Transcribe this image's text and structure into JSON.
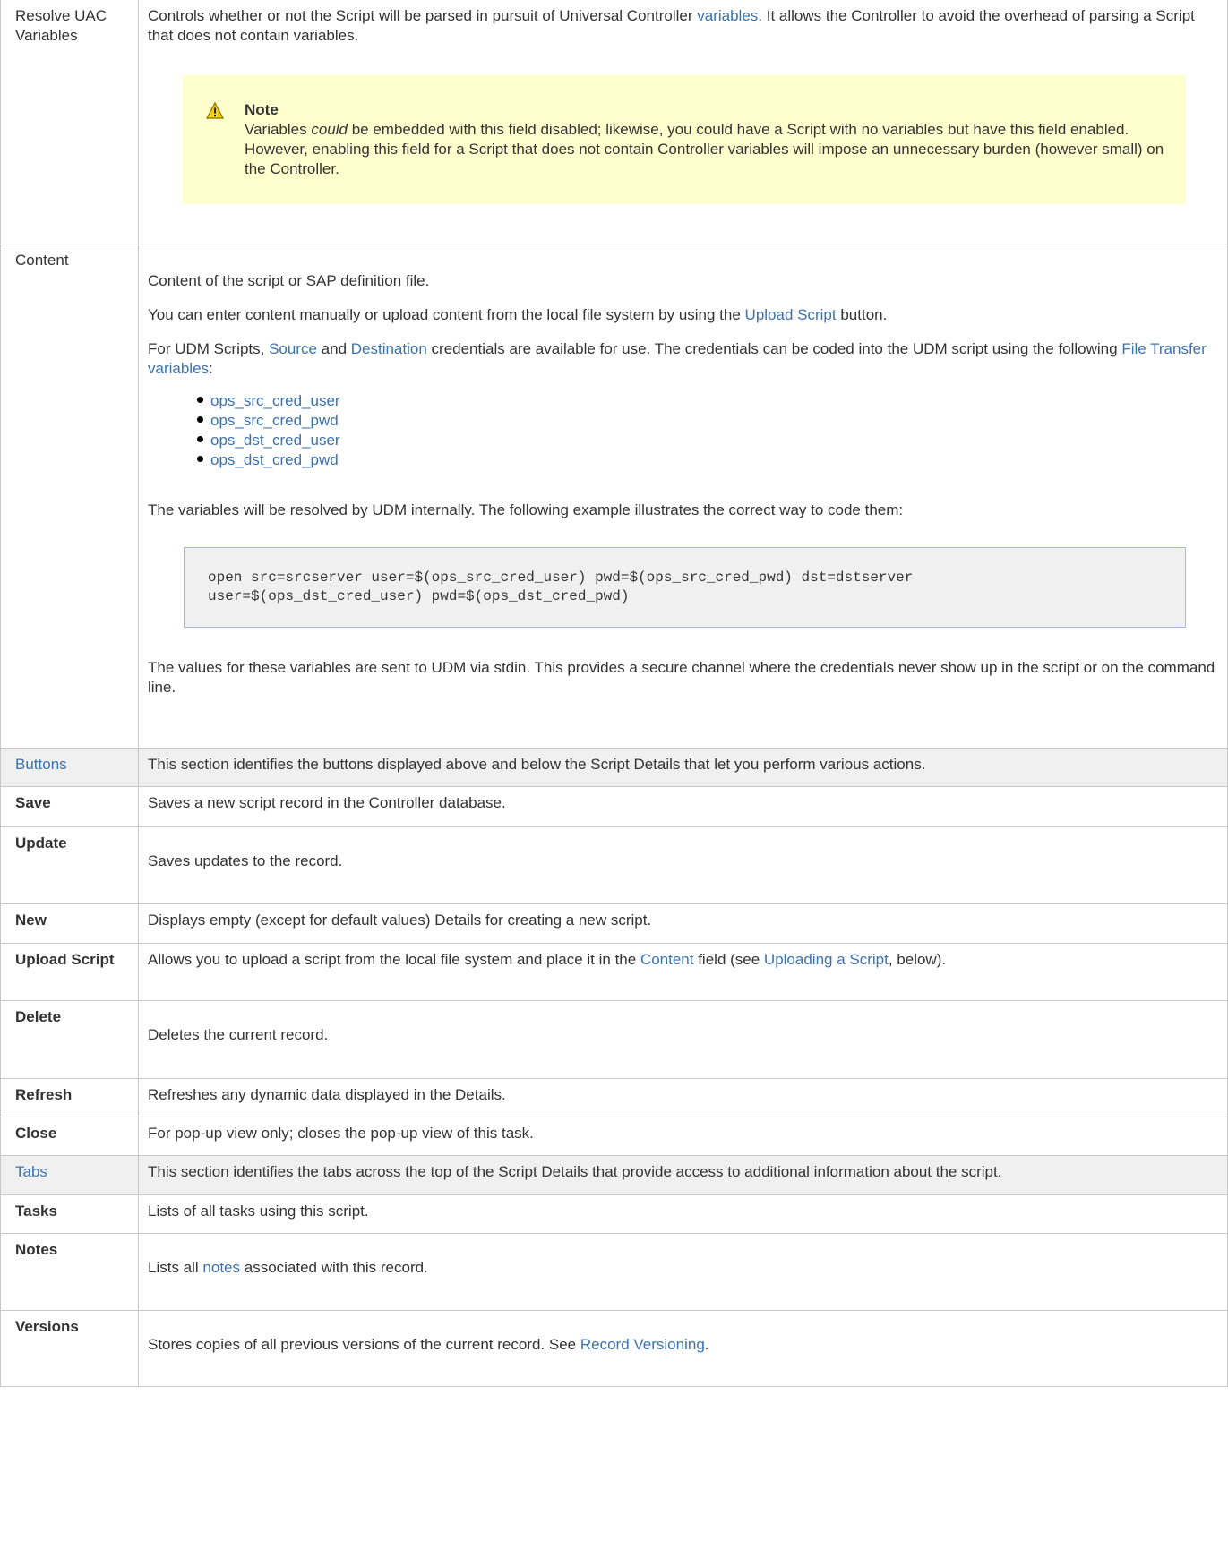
{
  "rows": {
    "resolve": {
      "label": "Resolve UAC Variables",
      "desc_a": "Controls whether or not the Script will be parsed in pursuit of Universal Controller ",
      "desc_link": "variables",
      "desc_b": ". It allows the Controller to avoid the overhead of parsing a Script that does not contain variables.",
      "note_title": "Note",
      "note_a": "Variables ",
      "note_em": "could",
      "note_b": " be embedded with this field disabled; likewise, you could have a Script with no variables but have this field enabled. However, enabling this field for a Script that does not contain Controller variables will impose an unnecessary burden (however small) on the Controller."
    },
    "content": {
      "label": "Content",
      "p1": "Content of the script or SAP definition file.",
      "p2_a": "You can enter content manually or upload content from the local file system by using the ",
      "p2_link": "Upload Script",
      "p2_b": " button.",
      "p3_a": "For UDM Scripts, ",
      "p3_link1": "Source",
      "p3_b": " and ",
      "p3_link2": "Destination",
      "p3_c": " credentials are available for use. The credentials can be coded into the UDM script using the following ",
      "p3_link3": "File Transfer variables",
      "p3_d": ":",
      "vars": [
        "ops_src_cred_user",
        "ops_src_cred_pwd",
        "ops_dst_cred_user",
        "ops_dst_cred_pwd"
      ],
      "p4": "The variables will be resolved by UDM internally. The following example illustrates the correct way to code them:",
      "code": "open src=srcserver user=$(ops_src_cred_user) pwd=$(ops_src_cred_pwd) dst=dstserver\nuser=$(ops_dst_cred_user) pwd=$(ops_dst_cred_pwd)",
      "p5": "The values for these variables are sent to UDM via stdin. This provides a secure channel where the credentials never show up in the script or on the command line."
    },
    "buttons": {
      "label": "Buttons",
      "desc": "This section identifies the buttons displayed above and below the Script Details that let you perform various actions."
    },
    "save": {
      "label": "Save",
      "desc": "Saves a new script record in the Controller database."
    },
    "update": {
      "label": "Update",
      "desc": "Saves updates to the record."
    },
    "new": {
      "label": "New",
      "desc": "Displays empty (except for default values) Details for creating a new script."
    },
    "upload": {
      "label": "Upload Script",
      "desc_a": "Allows you to upload a script from the local file system and place it in the ",
      "desc_link1": "Content",
      "desc_b": " field (see ",
      "desc_link2": "Uploading a Script",
      "desc_c": ", below)."
    },
    "delete": {
      "label": "Delete",
      "desc": "Deletes the current record."
    },
    "refresh": {
      "label": "Refresh",
      "desc": "Refreshes any dynamic data displayed in the Details."
    },
    "close": {
      "label": "Close",
      "desc": "For pop-up view only; closes the pop-up view of this task."
    },
    "tabs": {
      "label": "Tabs",
      "desc": "This section identifies the tabs across the top of the Script Details that provide access to additional information about the script."
    },
    "tasks": {
      "label": "Tasks",
      "desc": "Lists of all tasks using this script."
    },
    "notes": {
      "label": "Notes",
      "desc_a": "Lists all ",
      "desc_link": "notes",
      "desc_b": " associated with this record."
    },
    "versions": {
      "label": "Versions",
      "desc_a": "Stores copies of all previous versions of the current record. See ",
      "desc_link": "Record Versioning",
      "desc_b": "."
    }
  }
}
